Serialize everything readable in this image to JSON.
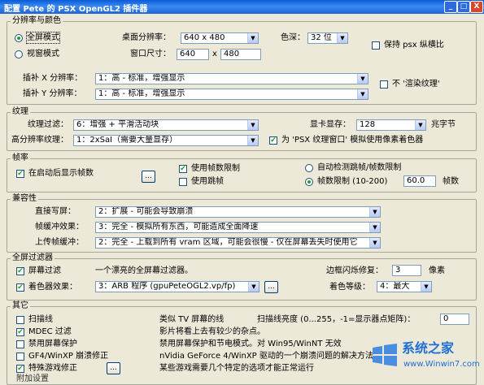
{
  "window": {
    "title": "配置 Pete 的 PSX OpenGL2 插件器",
    "min": "_",
    "max": "□",
    "close": "X"
  },
  "resolution_group": {
    "title": "分辨率与颜色",
    "fullscreen_label": "全屏模式",
    "windowed_label": "视窗模式",
    "desktop_res_label": "桌面分辨率：",
    "desktop_res_value": "640  x  480",
    "window_size_label": "窗口尺寸：",
    "window_w": "640",
    "x_sep": "x",
    "window_h": "480",
    "color_depth_label": "色深：",
    "color_depth_value": "32 位",
    "keep_ratio_label": "保持 psx 纵横比",
    "interp_x_label": "插补 X 分辨率：",
    "interp_x_value": "1：高 - 标准，增强显示",
    "interp_y_label": "插补 Y 分辨率：",
    "interp_y_value": "1：高 - 标准，增强显示",
    "no_render_tex_label": "不 '渲染纹理'"
  },
  "texture_group": {
    "title": "纹理",
    "filter_label": "纹理过滤：",
    "filter_value": "6：增强 + 平滑活动块",
    "vram_label": "显卡显存：",
    "vram_value": "128",
    "vram_unit": "兆字节",
    "hires_label": "高分辨率纹理：",
    "hires_value": "1：2xSaI（需要大量显存）",
    "psx_window_label": "为 'PSX 纹理窗口' 模拟使用像素着色器"
  },
  "fps_group": {
    "title": "帧率",
    "show_fps_label": "在启动后显示帧数",
    "btn_dots": "...",
    "use_limit_label": "使用帧数限制",
    "use_skip_label": "使用跳帧",
    "auto_detect_label": "自动检测跳帧/帧数限制",
    "fps_limit_label": "帧数限制 (10-200)",
    "fps_limit_value": "60.0",
    "fps_unit": "帧数"
  },
  "compat_group": {
    "title": "兼容性",
    "offscreen_label": "直接写屏：",
    "offscreen_value": "2：扩展 - 可能会导致崩溃",
    "fbtex_label": "帧缓冲效果：",
    "fbtex_value": "3：完全 - 模拟所有东西，可能造成全面降速",
    "fbacc_label": "上传帧缓冲：",
    "fbacc_value": "2：完全 - 上载到所有 vram 区域，可能会很慢 - 仅在屏幕丢失时使用它"
  },
  "fs_filter_group": {
    "title": "全屏过滤器",
    "screen_filter_label": "屏幕过滤",
    "screen_filter_desc": "一个漂亮的全屏幕过滤器。",
    "edge_label": "边框闪烁修复：",
    "edge_value": "3",
    "edge_unit": "像素",
    "shader_label": "着色器效果：",
    "shader_value": "3：ARB 程序 (gpuPeteOGL2.vp/fp)",
    "btn_dots": "...",
    "shader_level_label": "着色等级：",
    "shader_level_value": "4：最大"
  },
  "misc_group": {
    "title": "其它",
    "scanlines_label": "扫描线",
    "scanlines_desc": "类似 TV 屏幕的线",
    "scan_bright_label": "扫描线亮度 (0...255，-1=显示器点矩阵)：",
    "scan_bright_value": "0",
    "mdec_label": "MDEC 过滤",
    "mdec_desc": "影片将看上去有较少的杂点。",
    "disable_saver_label": "禁用屏幕保护",
    "disable_saver_desc": "禁用屏幕保护和节电模式。对 Win95/WinNT 无效",
    "gf4_label": "GF4/WinXP 崩溃修正",
    "gf4_desc": "nVidia GeForce 4/WinXP 驱动的一个崩溃问题的解决方法",
    "special_label": "特殊游戏修正",
    "btn_dots": "...",
    "special_desc": "某些游戏需要几个特定的选项才能正常运行",
    "bottom_cut": "附加设置"
  },
  "watermark": {
    "brand": "系统之家",
    "url": "www.Winwin7.com"
  },
  "colors": {
    "check": "#21a121",
    "title_bar": "#0a5bd8"
  }
}
